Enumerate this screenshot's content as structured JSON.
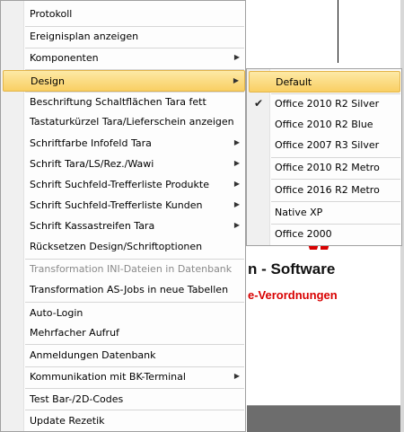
{
  "background": {
    "software": "n - Software",
    "verordnungen": "e-Verordnungen"
  },
  "menu": {
    "items": [
      {
        "label": "Protokoll"
      },
      {
        "label": "Ereignisplan anzeigen"
      },
      {
        "label": "Komponenten",
        "submenu": true
      },
      {
        "label": "Design",
        "submenu": true,
        "highlighted": true
      },
      {
        "label": "Beschriftung Schaltflächen Tara fett"
      },
      {
        "label": "Tastaturkürzel Tara/Lieferschein anzeigen"
      },
      {
        "label": "Schriftfarbe Infofeld Tara",
        "submenu": true
      },
      {
        "label": "Schrift Tara/LS/Rez./Wawi",
        "submenu": true
      },
      {
        "label": "Schrift Suchfeld-Trefferliste Produkte",
        "submenu": true
      },
      {
        "label": "Schrift Suchfeld-Trefferliste Kunden",
        "submenu": true
      },
      {
        "label": "Schrift Kassastreifen Tara",
        "submenu": true
      },
      {
        "label": "Rücksetzen Design/Schriftoptionen"
      },
      {
        "label": "Transformation INI-Dateien in Datenbank",
        "disabled": true
      },
      {
        "label": "Transformation AS-Jobs in neue Tabellen"
      },
      {
        "label": "Auto-Login"
      },
      {
        "label": "Mehrfacher Aufruf"
      },
      {
        "label": "Anmeldungen Datenbank"
      },
      {
        "label": "Kommunikation mit BK-Terminal",
        "submenu": true
      },
      {
        "label": "Test Bar-/2D-Codes"
      },
      {
        "label": "Update Rezetik"
      }
    ]
  },
  "design_submenu": {
    "items": [
      {
        "label": "Default",
        "highlighted": true
      },
      {
        "label": "Office 2010 R2 Silver",
        "checked": true
      },
      {
        "label": "Office 2010 R2 Blue"
      },
      {
        "label": "Office 2007 R3 Silver"
      },
      {
        "label": "Office 2010 R2 Metro"
      },
      {
        "label": "Office 2016 R2 Metro"
      },
      {
        "label": "Native XP"
      },
      {
        "label": "Office 2000"
      }
    ]
  },
  "colors": {
    "highlight": "#f9cf63",
    "accent_text": "#d80000"
  }
}
